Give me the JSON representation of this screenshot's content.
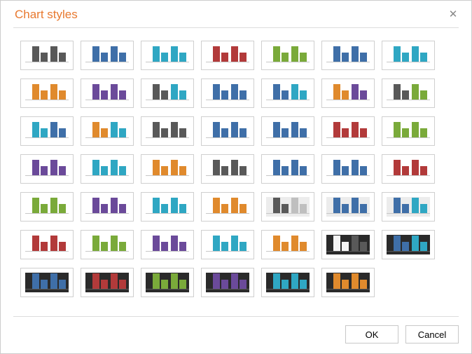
{
  "dialog": {
    "title": "Chart styles",
    "ok_label": "OK",
    "cancel_label": "Cancel"
  },
  "palette": {
    "gray": "#595959",
    "blue": "#3f6fa8",
    "cyan": "#2fa7c3",
    "red": "#b23a3a",
    "green": "#7aaa3a",
    "orange": "#e08a2d",
    "purple": "#6b4a9a",
    "lightgray": "#bfbfbf",
    "white": "#f4f4f4"
  },
  "tiles": [
    {
      "row": 0,
      "bars": [
        [
          "gray",
          "gray"
        ],
        [
          "blue",
          "blue"
        ],
        [
          "cyan",
          "cyan"
        ],
        [
          "red",
          "red"
        ],
        [
          "green",
          "green"
        ],
        [
          "blue",
          "blue"
        ],
        [
          "cyan",
          "cyan"
        ]
      ],
      "plot": "light"
    },
    {
      "row": 1,
      "bars": [
        [
          "orange",
          "orange"
        ],
        [
          "purple",
          "purple"
        ],
        [
          "gray",
          "cyan"
        ],
        [
          "blue",
          "blue"
        ],
        [
          "blue",
          "cyan"
        ],
        [
          "orange",
          "purple"
        ],
        [
          "gray",
          "green"
        ]
      ],
      "plot": "light"
    },
    {
      "row": 2,
      "bars": [
        [
          "cyan",
          "blue"
        ],
        [
          "orange",
          "cyan"
        ],
        [
          "gray",
          "gray"
        ],
        [
          "blue",
          "blue"
        ],
        [
          "blue",
          "blue"
        ],
        [
          "red",
          "red"
        ],
        [
          "green",
          "green"
        ]
      ],
      "plot": "light"
    },
    {
      "row": 3,
      "bars": [
        [
          "purple",
          "purple"
        ],
        [
          "cyan",
          "cyan"
        ],
        [
          "orange",
          "orange"
        ],
        [
          "gray",
          "gray"
        ],
        [
          "blue",
          "blue"
        ],
        [
          "blue",
          "blue"
        ],
        [
          "red",
          "red"
        ]
      ],
      "plot": "light"
    },
    {
      "row": 4,
      "bars": [
        [
          "green",
          "green"
        ],
        [
          "purple",
          "purple"
        ],
        [
          "cyan",
          "cyan"
        ],
        [
          "orange",
          "orange"
        ],
        [
          "gray",
          "lightgray"
        ],
        [
          "blue",
          "blue"
        ],
        [
          "blue",
          "cyan"
        ]
      ],
      "plot": "light",
      "plotOverrides": {
        "4": "lightbg",
        "5": "lightbg",
        "6": "lightbg"
      }
    },
    {
      "row": 5,
      "bars": [
        [
          "red",
          "red"
        ],
        [
          "green",
          "green"
        ],
        [
          "purple",
          "purple"
        ],
        [
          "cyan",
          "cyan"
        ],
        [
          "orange",
          "orange"
        ],
        [
          "white",
          "gray"
        ],
        [
          "blue",
          "cyan"
        ]
      ],
      "plot": "light",
      "plotOverrides": {
        "5": "dark",
        "6": "dark"
      }
    },
    {
      "row": 6,
      "bars": [
        [
          "blue",
          "blue"
        ],
        [
          "red",
          "red"
        ],
        [
          "green",
          "green"
        ],
        [
          "purple",
          "purple"
        ],
        [
          "cyan",
          "cyan"
        ],
        [
          "orange",
          "orange"
        ]
      ],
      "plot": "dark"
    }
  ]
}
